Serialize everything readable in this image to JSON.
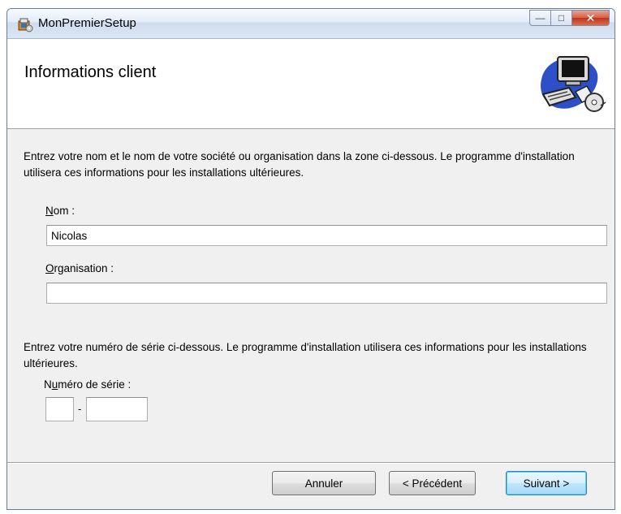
{
  "window": {
    "title": "MonPremierSetup",
    "caption_buttons": {
      "minimize": "—",
      "maximize": "□",
      "close": "✕"
    }
  },
  "header": {
    "title": "Informations client",
    "graphic_icon": "computer-setup-icon"
  },
  "intro_text": "Entrez votre nom et le nom de votre société ou organisation dans la zone ci-dessous. Le programme d'installation utilisera ces informations pour les installations ultérieures.",
  "name_field": {
    "label_first": "N",
    "label_rest": "om :",
    "value": "Nicolas"
  },
  "org_field": {
    "label_first": "O",
    "label_rest": "rganisation :",
    "value": ""
  },
  "serial_text": "Entrez votre numéro de série ci-dessous. Le programme d'installation utilisera ces informations pour les installations ultérieures.",
  "serial_field": {
    "label_pre": "N",
    "label_under": "u",
    "label_post": "méro de série :",
    "separator": "-",
    "part1": "",
    "part2": ""
  },
  "buttons": {
    "cancel": "Annuler",
    "previous": "< Précédent",
    "next": "Suivant >"
  },
  "colors": {
    "dialog_bg": "#f0f0f0",
    "default_button_border": "#3c7fb1",
    "close_button": "#c0331b"
  }
}
